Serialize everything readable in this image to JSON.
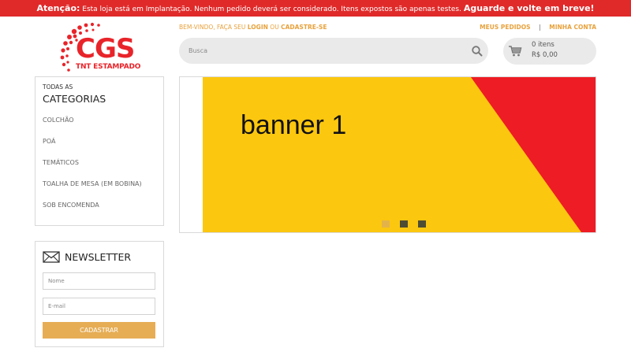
{
  "alert": {
    "prefix": "Atenção:",
    "message": "Esta loja está em Implantação. Nenhum pedido deverá ser considerado. Itens expostos são apenas testes.",
    "cta": "Aguarde e volte em breve!"
  },
  "logo": {
    "brand": "CGS",
    "tagline": "TNT ESTAMPADO"
  },
  "header": {
    "welcome_text": "BEM-VINDO, FAÇA SEU",
    "login_label": "LOGIN",
    "or_text": "OU",
    "register_label": "CADASTRE-SE",
    "my_orders_label": "MEUS PEDIDOS",
    "separator": "|",
    "my_account_label": "MINHA CONTA"
  },
  "search": {
    "placeholder": "Busca",
    "icon": "search-icon"
  },
  "cart": {
    "items_label": "0 itens",
    "total_label": "R$ 0,00",
    "icon": "cart-icon"
  },
  "categories": {
    "heading_small": "TODAS AS",
    "heading": "CATEGORIAS",
    "items": [
      {
        "label": "COLCHÃO"
      },
      {
        "label": "POÁ"
      },
      {
        "label": "TEMÁTICOS"
      },
      {
        "label": "TOALHA DE MESA (EM BOBINA)"
      },
      {
        "label": "SOB ENCOMENDA"
      }
    ]
  },
  "newsletter": {
    "title": "NEWSLETTER",
    "name_placeholder": "Nome",
    "email_placeholder": "E-mail",
    "submit_label": "CADASTRAR",
    "icon": "envelope-icon"
  },
  "banner": {
    "text": "banner 1",
    "colors": {
      "background": "#fcc70f",
      "accent": "#ee1c24"
    },
    "slides": 3,
    "active_slide": 1
  },
  "colors": {
    "alert_bg": "#e02a2a",
    "brand": "#e8242a",
    "link": "#e8a23c",
    "button": "#e6ad55"
  }
}
